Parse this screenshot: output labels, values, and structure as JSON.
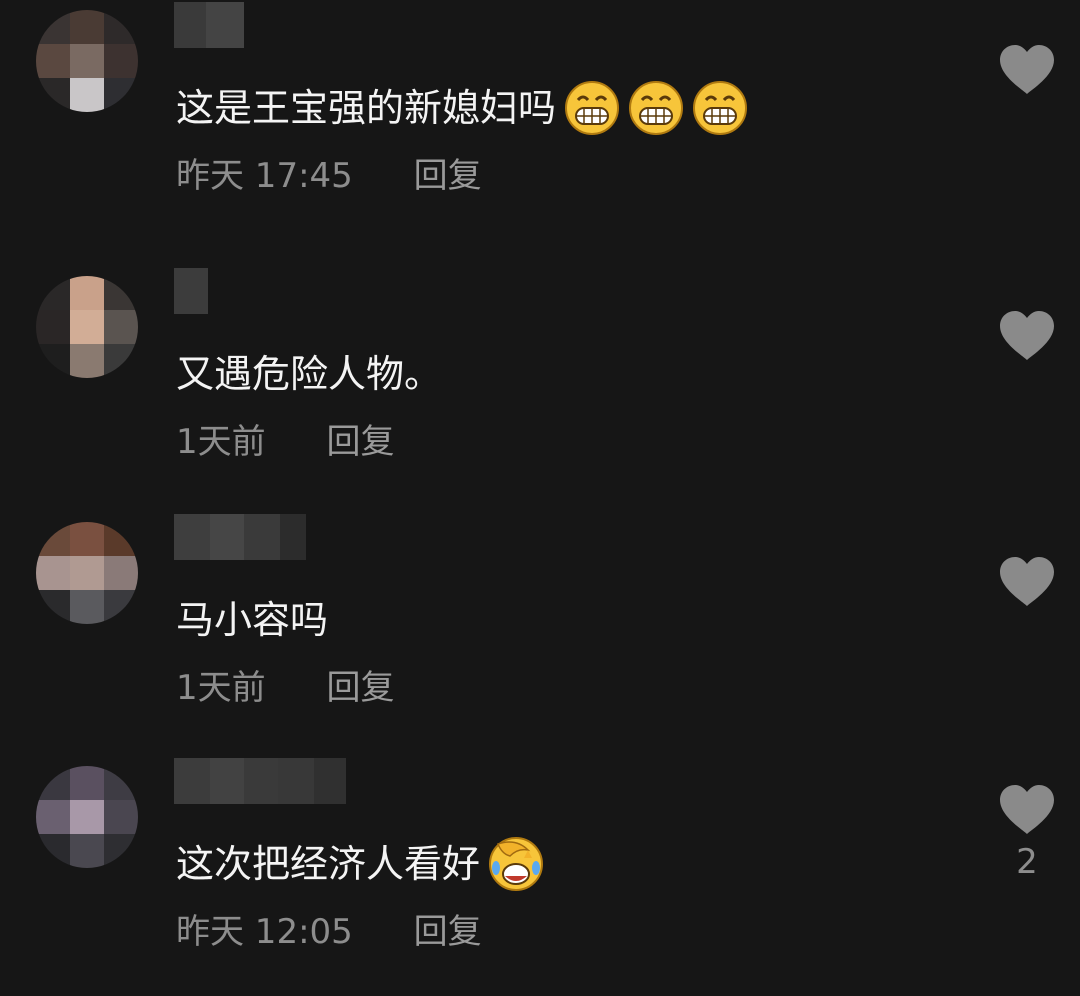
{
  "comments": [
    {
      "text": "这是王宝强的新媳妇吗",
      "emojis": [
        "grin-emoji",
        "grin-emoji",
        "grin-emoji"
      ],
      "time": "昨天 17:45",
      "reply_label": "回复",
      "like_count": ""
    },
    {
      "text": "又遇危险人物。",
      "emojis": [],
      "time": "1天前",
      "reply_label": "回复",
      "like_count": ""
    },
    {
      "text": "马小容吗",
      "emojis": [],
      "time": "1天前",
      "reply_label": "回复",
      "like_count": ""
    },
    {
      "text": "这次把经济人看好",
      "emojis": [
        "facepalm-laugh-emoji"
      ],
      "time": "昨天 12:05",
      "reply_label": "回复",
      "like_count": "2"
    }
  ],
  "colors": {
    "background": "#161616",
    "text": "#f4f4f4",
    "meta": "#8d8d8d",
    "heart": "#8a8a8a"
  }
}
